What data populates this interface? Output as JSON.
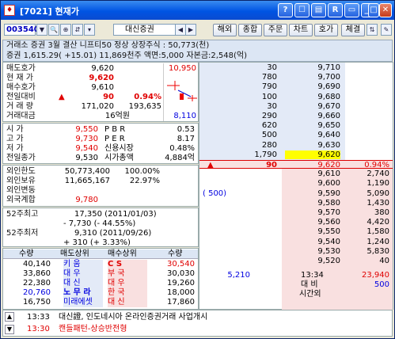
{
  "window": {
    "title": "[7021] 현재가",
    "icon": "app-icon-7021",
    "buttons": [
      "?",
      "☐",
      "▤",
      "R",
      "▭",
      "_",
      "□",
      "✕"
    ]
  },
  "toolbar": {
    "code": "003540",
    "name": "대신증권",
    "buttons": [
      "해외",
      "종합",
      "주문",
      "차트",
      "호가",
      "체결"
    ]
  },
  "info": {
    "line1": "거래소 증권 3월 결산  니프티50 정상  상장주식 : 50,773(천)",
    "line2": "증권 1,615.29( +15.01) 11,869천주 액면:5,000 자본금:2,548(억)"
  },
  "quote": {
    "rows": [
      {
        "label": "매도호가",
        "value": "9,620"
      },
      {
        "label": "현 재 가",
        "value": "9,620"
      },
      {
        "label": "매수호가",
        "value": "9,610"
      },
      {
        "label": "전일대비",
        "arrow": "▲",
        "value": "90",
        "pct": "0.94%"
      },
      {
        "label": "거 래 량",
        "value": "171,020",
        "value2": "193,635"
      },
      {
        "label": "거래대금",
        "value": "16억원"
      }
    ],
    "mini_hi": "10,950",
    "mini_lo": "8,110"
  },
  "ohlc": {
    "rows": [
      {
        "label": "시    가",
        "value": "9,550",
        "k": "P B R",
        "v": "0.53"
      },
      {
        "label": "고    가",
        "value": "9,730",
        "k": "P E R",
        "v": "8.17"
      },
      {
        "label": "저    가",
        "value": "9,540",
        "k": "신용시장",
        "v": "0.48%"
      },
      {
        "label": "전일종가",
        "value": "9,530",
        "k": "시가총액",
        "v": "4,884억"
      }
    ]
  },
  "foreign": {
    "rows": [
      {
        "label": "외인한도",
        "value": "50,773,400",
        "v2": "100.00%"
      },
      {
        "label": "외인보유",
        "value": "11,665,167",
        "v2": "22.97%"
      },
      {
        "label": "외인변동",
        "value": "",
        "v2": ""
      },
      {
        "label": "외국계합",
        "value": "9,780",
        "v2": ""
      }
    ]
  },
  "week52": {
    "high_label": "52주최고",
    "high": "17,350 (2011/01/03)",
    "high_diff": "-   7,730 (-  44.55%)",
    "low_label": "52주최저",
    "low": "9,310 (2011/09/26)",
    "low_diff": "+    310 (+   3.33%)"
  },
  "brokers": {
    "headers": [
      "수량",
      "매도상위",
      "매수상위",
      "수량"
    ],
    "rows": [
      {
        "sq": "40,140",
        "sn": "키    움",
        "bn": "C S",
        "bq": "30,540"
      },
      {
        "sq": "33,860",
        "sn": "대    우",
        "bn": "부    국",
        "bq": "30,030"
      },
      {
        "sq": "22,380",
        "sn": "대    신",
        "bn": "대    우",
        "bq": "19,260"
      },
      {
        "sq": "20,760",
        "sn": "노 무 라",
        "bn": "한    국",
        "bq": "18,000"
      },
      {
        "sq": "16,750",
        "sn": "미래에셋",
        "bn": "대    신",
        "bq": "17,860"
      }
    ]
  },
  "orderbook": {
    "asks": [
      {
        "qty": "30",
        "price": "9,710"
      },
      {
        "qty": "780",
        "price": "9,700"
      },
      {
        "qty": "790",
        "price": "9,690"
      },
      {
        "qty": "100",
        "price": "9,680"
      },
      {
        "qty": "30",
        "price": "9,670"
      },
      {
        "qty": "290",
        "price": "9,660"
      },
      {
        "qty": "620",
        "price": "9,650"
      },
      {
        "qty": "500",
        "price": "9,640"
      },
      {
        "qty": "280",
        "price": "9,630"
      },
      {
        "qty": "1,790",
        "price": "9,620"
      }
    ],
    "current": {
      "arrow": "▲",
      "change": "90",
      "price": "9,620",
      "pct": "0.94%"
    },
    "bids": [
      {
        "extra": "",
        "price": "9,610",
        "qty": "2,740"
      },
      {
        "extra": "",
        "price": "9,600",
        "qty": "1,190"
      },
      {
        "extra": "(      500)",
        "price": "9,590",
        "qty": "5,090"
      },
      {
        "extra": "",
        "price": "9,580",
        "qty": "1,430"
      },
      {
        "extra": "",
        "price": "9,570",
        "qty": "380"
      },
      {
        "extra": "",
        "price": "9,560",
        "qty": "4,420"
      },
      {
        "extra": "",
        "price": "9,550",
        "qty": "1,580"
      },
      {
        "extra": "",
        "price": "9,540",
        "qty": "1,240"
      },
      {
        "extra": "",
        "price": "9,530",
        "qty": "5,830"
      },
      {
        "extra": "",
        "price": "9,520",
        "qty": "40"
      }
    ],
    "total_ask": "5,210",
    "time": "13:34",
    "total_bid": "23,940",
    "label_vs": "대    비",
    "vs_value": "500",
    "label_after": "시간외"
  },
  "news": [
    {
      "time": "13:33",
      "text": "대신證, 인도네시아 온라인증권거래 사업개시"
    },
    {
      "time": "13:30",
      "text": "캔들패턴-상승반전형"
    }
  ],
  "colors": {
    "up": "#e00000",
    "down": "#0000e0",
    "ask_bg": "#e3eaf7",
    "bid_bg": "#f9e0e0",
    "highlight": "#ffff00"
  }
}
